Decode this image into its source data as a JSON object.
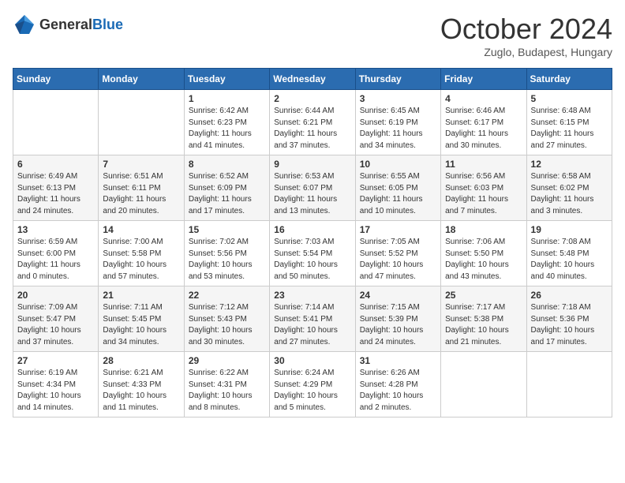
{
  "header": {
    "logo_general": "General",
    "logo_blue": "Blue",
    "month_title": "October 2024",
    "location": "Zuglo, Budapest, Hungary"
  },
  "days_of_week": [
    "Sunday",
    "Monday",
    "Tuesday",
    "Wednesday",
    "Thursday",
    "Friday",
    "Saturday"
  ],
  "weeks": [
    [
      {
        "day": "",
        "sunrise": "",
        "sunset": "",
        "daylight": ""
      },
      {
        "day": "",
        "sunrise": "",
        "sunset": "",
        "daylight": ""
      },
      {
        "day": "1",
        "sunrise": "Sunrise: 6:42 AM",
        "sunset": "Sunset: 6:23 PM",
        "daylight": "Daylight: 11 hours and 41 minutes."
      },
      {
        "day": "2",
        "sunrise": "Sunrise: 6:44 AM",
        "sunset": "Sunset: 6:21 PM",
        "daylight": "Daylight: 11 hours and 37 minutes."
      },
      {
        "day": "3",
        "sunrise": "Sunrise: 6:45 AM",
        "sunset": "Sunset: 6:19 PM",
        "daylight": "Daylight: 11 hours and 34 minutes."
      },
      {
        "day": "4",
        "sunrise": "Sunrise: 6:46 AM",
        "sunset": "Sunset: 6:17 PM",
        "daylight": "Daylight: 11 hours and 30 minutes."
      },
      {
        "day": "5",
        "sunrise": "Sunrise: 6:48 AM",
        "sunset": "Sunset: 6:15 PM",
        "daylight": "Daylight: 11 hours and 27 minutes."
      }
    ],
    [
      {
        "day": "6",
        "sunrise": "Sunrise: 6:49 AM",
        "sunset": "Sunset: 6:13 PM",
        "daylight": "Daylight: 11 hours and 24 minutes."
      },
      {
        "day": "7",
        "sunrise": "Sunrise: 6:51 AM",
        "sunset": "Sunset: 6:11 PM",
        "daylight": "Daylight: 11 hours and 20 minutes."
      },
      {
        "day": "8",
        "sunrise": "Sunrise: 6:52 AM",
        "sunset": "Sunset: 6:09 PM",
        "daylight": "Daylight: 11 hours and 17 minutes."
      },
      {
        "day": "9",
        "sunrise": "Sunrise: 6:53 AM",
        "sunset": "Sunset: 6:07 PM",
        "daylight": "Daylight: 11 hours and 13 minutes."
      },
      {
        "day": "10",
        "sunrise": "Sunrise: 6:55 AM",
        "sunset": "Sunset: 6:05 PM",
        "daylight": "Daylight: 11 hours and 10 minutes."
      },
      {
        "day": "11",
        "sunrise": "Sunrise: 6:56 AM",
        "sunset": "Sunset: 6:03 PM",
        "daylight": "Daylight: 11 hours and 7 minutes."
      },
      {
        "day": "12",
        "sunrise": "Sunrise: 6:58 AM",
        "sunset": "Sunset: 6:02 PM",
        "daylight": "Daylight: 11 hours and 3 minutes."
      }
    ],
    [
      {
        "day": "13",
        "sunrise": "Sunrise: 6:59 AM",
        "sunset": "Sunset: 6:00 PM",
        "daylight": "Daylight: 11 hours and 0 minutes."
      },
      {
        "day": "14",
        "sunrise": "Sunrise: 7:00 AM",
        "sunset": "Sunset: 5:58 PM",
        "daylight": "Daylight: 10 hours and 57 minutes."
      },
      {
        "day": "15",
        "sunrise": "Sunrise: 7:02 AM",
        "sunset": "Sunset: 5:56 PM",
        "daylight": "Daylight: 10 hours and 53 minutes."
      },
      {
        "day": "16",
        "sunrise": "Sunrise: 7:03 AM",
        "sunset": "Sunset: 5:54 PM",
        "daylight": "Daylight: 10 hours and 50 minutes."
      },
      {
        "day": "17",
        "sunrise": "Sunrise: 7:05 AM",
        "sunset": "Sunset: 5:52 PM",
        "daylight": "Daylight: 10 hours and 47 minutes."
      },
      {
        "day": "18",
        "sunrise": "Sunrise: 7:06 AM",
        "sunset": "Sunset: 5:50 PM",
        "daylight": "Daylight: 10 hours and 43 minutes."
      },
      {
        "day": "19",
        "sunrise": "Sunrise: 7:08 AM",
        "sunset": "Sunset: 5:48 PM",
        "daylight": "Daylight: 10 hours and 40 minutes."
      }
    ],
    [
      {
        "day": "20",
        "sunrise": "Sunrise: 7:09 AM",
        "sunset": "Sunset: 5:47 PM",
        "daylight": "Daylight: 10 hours and 37 minutes."
      },
      {
        "day": "21",
        "sunrise": "Sunrise: 7:11 AM",
        "sunset": "Sunset: 5:45 PM",
        "daylight": "Daylight: 10 hours and 34 minutes."
      },
      {
        "day": "22",
        "sunrise": "Sunrise: 7:12 AM",
        "sunset": "Sunset: 5:43 PM",
        "daylight": "Daylight: 10 hours and 30 minutes."
      },
      {
        "day": "23",
        "sunrise": "Sunrise: 7:14 AM",
        "sunset": "Sunset: 5:41 PM",
        "daylight": "Daylight: 10 hours and 27 minutes."
      },
      {
        "day": "24",
        "sunrise": "Sunrise: 7:15 AM",
        "sunset": "Sunset: 5:39 PM",
        "daylight": "Daylight: 10 hours and 24 minutes."
      },
      {
        "day": "25",
        "sunrise": "Sunrise: 7:17 AM",
        "sunset": "Sunset: 5:38 PM",
        "daylight": "Daylight: 10 hours and 21 minutes."
      },
      {
        "day": "26",
        "sunrise": "Sunrise: 7:18 AM",
        "sunset": "Sunset: 5:36 PM",
        "daylight": "Daylight: 10 hours and 17 minutes."
      }
    ],
    [
      {
        "day": "27",
        "sunrise": "Sunrise: 6:19 AM",
        "sunset": "Sunset: 4:34 PM",
        "daylight": "Daylight: 10 hours and 14 minutes."
      },
      {
        "day": "28",
        "sunrise": "Sunrise: 6:21 AM",
        "sunset": "Sunset: 4:33 PM",
        "daylight": "Daylight: 10 hours and 11 minutes."
      },
      {
        "day": "29",
        "sunrise": "Sunrise: 6:22 AM",
        "sunset": "Sunset: 4:31 PM",
        "daylight": "Daylight: 10 hours and 8 minutes."
      },
      {
        "day": "30",
        "sunrise": "Sunrise: 6:24 AM",
        "sunset": "Sunset: 4:29 PM",
        "daylight": "Daylight: 10 hours and 5 minutes."
      },
      {
        "day": "31",
        "sunrise": "Sunrise: 6:26 AM",
        "sunset": "Sunset: 4:28 PM",
        "daylight": "Daylight: 10 hours and 2 minutes."
      },
      {
        "day": "",
        "sunrise": "",
        "sunset": "",
        "daylight": ""
      },
      {
        "day": "",
        "sunrise": "",
        "sunset": "",
        "daylight": ""
      }
    ]
  ]
}
